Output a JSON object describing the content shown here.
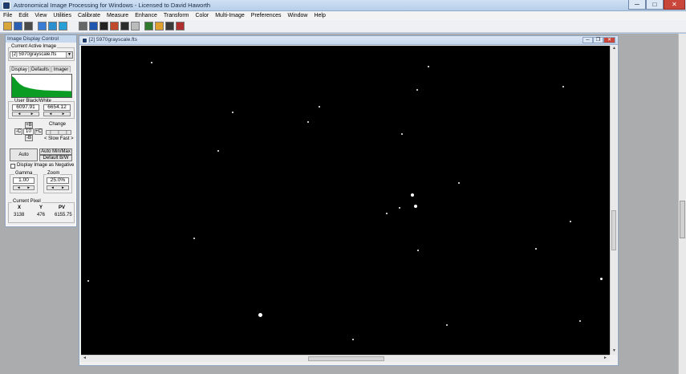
{
  "app": {
    "title": "Astronomical Image Processing for Windows - Licensed to David Haworth",
    "window_controls": {
      "minimize": "─",
      "maximize": "□",
      "close": "✕"
    }
  },
  "menu": [
    "File",
    "Edit",
    "View",
    "Utilities",
    "Calibrate",
    "Measure",
    "Enhance",
    "Transform",
    "Color",
    "Multi-Image",
    "Preferences",
    "Window",
    "Help"
  ],
  "toolbar": {
    "icons": [
      "open-icon",
      "save-icon",
      "print-icon",
      "histogram-icon",
      "histogram-icon-2",
      "histogram-icon-3",
      "copy-icon",
      "info-icon",
      "stretch-icon",
      "contrast-icon",
      "fits-icon",
      "grid-icon",
      "color-icon",
      "palette-icon",
      "settings-icon",
      "book-icon"
    ],
    "colors": [
      "#d9a63a",
      "#2b5fb4",
      "#4a4a4a",
      "#3a7bd5",
      "#2c8fd0",
      "#26a0d6",
      "#666",
      "#1f57b0",
      "#222",
      "#c24a2c",
      "#2b2b2b",
      "#bbb",
      "#2f7a2f",
      "#e0a030",
      "#3a3a3a",
      "#b03030"
    ]
  },
  "control_panel": {
    "title": "Image Display Control",
    "current_active_image_label": "Current Active Image",
    "current_active_image_value": "[2] 5970grayscale.fts",
    "tabs": [
      "Display",
      "Defaults",
      "Imager"
    ],
    "user_bw_label": "User Black/White",
    "black_value": "6097.91",
    "white_value": "6654.12",
    "b_plus": "+B",
    "b_minus": "-B",
    "c_minus": "-C",
    "c_plus": "+C",
    "step_value": "10",
    "change_label": "Change",
    "speed_label": "< Slow Fast >",
    "auto_button": "Auto",
    "auto_minmax_button": "Auto Min/Max",
    "default_bw_button": "Default B/W",
    "negative_label": "Display Image as Negative",
    "gamma_label": "Gamma",
    "gamma_value": "1.00",
    "zoom_label": "Zoom",
    "zoom_value": "25.0%",
    "current_pixel_label": "Current Pixel",
    "x_label": "X",
    "y_label": "Y",
    "pv_label": "PV",
    "x_value": "3138",
    "y_value": "476",
    "pv_value": "6155.75"
  },
  "image_window": {
    "title": "[2] 5970grayscale.fts",
    "controls": {
      "minimize": "─",
      "restore": "❐",
      "close": "✕"
    }
  }
}
